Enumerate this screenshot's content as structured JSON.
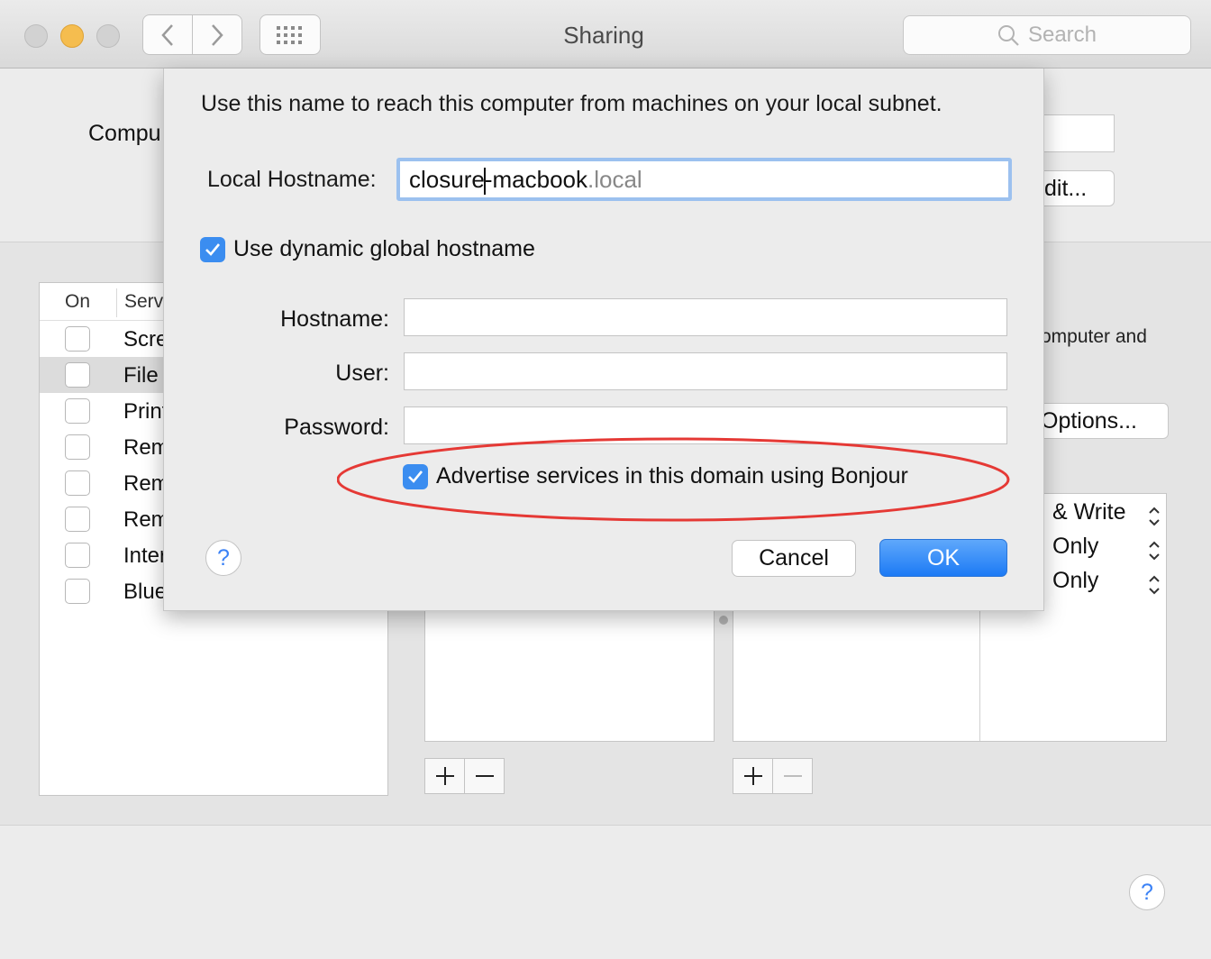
{
  "window": {
    "title": "Sharing",
    "search_placeholder": "Search"
  },
  "background": {
    "computer_name_label": "Compu",
    "edit_button": "dit...",
    "services_header": {
      "on": "On",
      "service": "Serv"
    },
    "services": [
      {
        "name": "Scre",
        "on": false
      },
      {
        "name": "File",
        "on": false,
        "selected": true
      },
      {
        "name": "Print",
        "on": false
      },
      {
        "name": "Rem",
        "on": false
      },
      {
        "name": "Rem",
        "on": false
      },
      {
        "name": "Rem",
        "on": false
      },
      {
        "name": "Inter",
        "on": false
      },
      {
        "name": "Blue",
        "on": false
      }
    ],
    "description_fragment": "omputer and",
    "options_button": "Options...",
    "permissions": [
      "& Write",
      "Only",
      "Only"
    ]
  },
  "sheet": {
    "intro": "Use this name to reach this computer from machines on your local subnet.",
    "local_hostname_label": "Local Hostname:",
    "local_hostname_value": "closure-macbook",
    "local_hostname_suffix": ".local",
    "dynamic_checkbox_label": "Use dynamic global hostname",
    "dynamic_checked": true,
    "hostname_label": "Hostname:",
    "hostname_value": "",
    "user_label": "User:",
    "user_value": "",
    "password_label": "Password:",
    "password_value": "",
    "bonjour_label": "Advertise services in this domain using Bonjour",
    "bonjour_checked": true,
    "help": "?",
    "cancel_button": "Cancel",
    "ok_button": "OK"
  },
  "colors": {
    "accent": "#3b8df0",
    "annotation": "#e53935",
    "traffic_minimize": "#f5bd4f"
  },
  "icons": [
    "back-arrow-icon",
    "forward-arrow-icon",
    "grid-icon",
    "search-icon",
    "checkmark-icon",
    "plus-icon",
    "minus-icon",
    "updown-stepper-icon"
  ]
}
